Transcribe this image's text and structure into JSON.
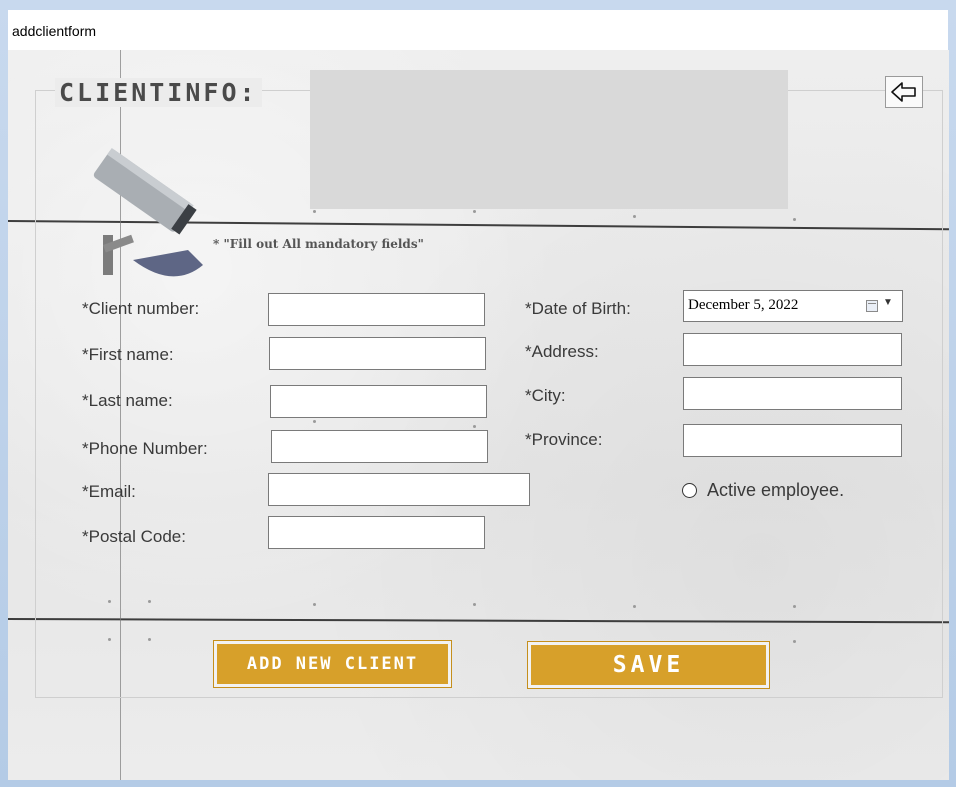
{
  "window": {
    "title": "addclientform"
  },
  "header": {
    "heading": "CLIENTINFO:",
    "back_icon": "back-arrow-icon",
    "hint": "* \"Fill out All mandatory fields\""
  },
  "left_fields": [
    {
      "label": "*Client number:",
      "value": ""
    },
    {
      "label": "*First name:",
      "value": ""
    },
    {
      "label": "*Last name:",
      "value": ""
    },
    {
      "label": "*Phone Number:",
      "value": ""
    },
    {
      "label": "*Email:",
      "value": ""
    },
    {
      "label": "*Postal Code:",
      "value": ""
    }
  ],
  "right_fields": {
    "dob": {
      "label": "*Date of Birth:",
      "value": "December  5, 2022"
    },
    "address": {
      "label": "*Address:",
      "value": ""
    },
    "city": {
      "label": "*City:",
      "value": ""
    },
    "province": {
      "label": "*Province:",
      "value": ""
    }
  },
  "active_employee": {
    "label": "Active employee.",
    "checked": false
  },
  "buttons": {
    "add_new_client": "ADD NEW CLIENT",
    "save": "SAVE"
  },
  "colors": {
    "button": "#d7a02a",
    "banner": "#d9d9d9"
  }
}
